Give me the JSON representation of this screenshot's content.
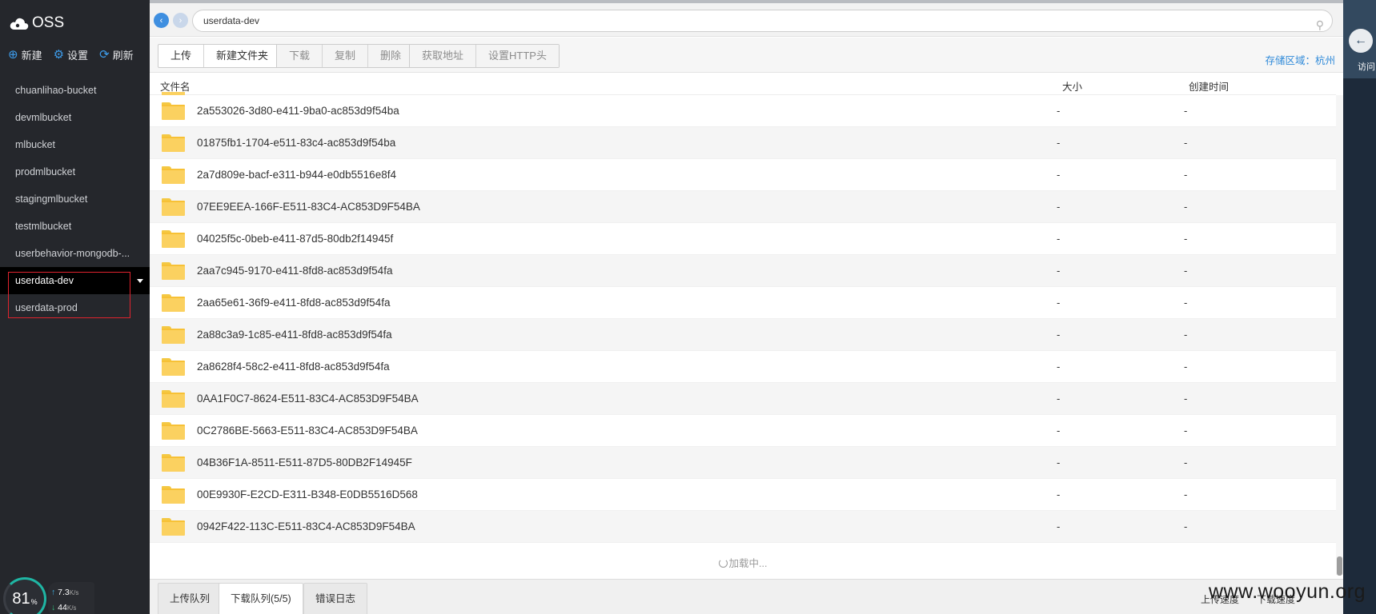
{
  "app": {
    "logo_text": "OSS"
  },
  "sidebar": {
    "actions": [
      {
        "icon": "plus-circle-icon",
        "label": "新建"
      },
      {
        "icon": "gear-icon",
        "label": "设置"
      },
      {
        "icon": "refresh-icon",
        "label": "刷新"
      }
    ],
    "buckets": [
      {
        "label": "chuanlihao-bucket"
      },
      {
        "label": "devmlbucket"
      },
      {
        "label": "mlbucket"
      },
      {
        "label": "prodmlbucket"
      },
      {
        "label": "stagingmlbucket"
      },
      {
        "label": "testmlbucket"
      },
      {
        "label": "userbehavior-mongodb-..."
      },
      {
        "label": "userdata-dev",
        "active": true
      },
      {
        "label": "userdata-prod"
      }
    ],
    "gauge": {
      "value": "81",
      "unit": "%"
    },
    "speed": {
      "up": "7.3",
      "up_unit": "K/s",
      "down": "44",
      "down_unit": "K/s"
    }
  },
  "nav": {
    "address": "userdata-dev"
  },
  "toolbar": {
    "group1": [
      "上传",
      "新建文件夹"
    ],
    "group2": [
      "下载",
      "复制",
      "删除"
    ],
    "group3": [
      "获取地址",
      "设置HTTP头"
    ],
    "region": "存储区域：杭州"
  },
  "list": {
    "headers": {
      "name": "文件名",
      "size": "大小",
      "time": "创建时间"
    },
    "rows": [
      {
        "name": "2a553026-3d80-e411-9ba0-ac853d9f54ba",
        "size": "-",
        "time": "-"
      },
      {
        "name": "01875fb1-1704-e511-83c4-ac853d9f54ba",
        "size": "-",
        "time": "-"
      },
      {
        "name": "2a7d809e-bacf-e311-b944-e0db5516e8f4",
        "size": "-",
        "time": "-"
      },
      {
        "name": "07EE9EEA-166F-E511-83C4-AC853D9F54BA",
        "size": "-",
        "time": "-"
      },
      {
        "name": "04025f5c-0beb-e411-87d5-80db2f14945f",
        "size": "-",
        "time": "-"
      },
      {
        "name": "2aa7c945-9170-e411-8fd8-ac853d9f54fa",
        "size": "-",
        "time": "-"
      },
      {
        "name": "2aa65e61-36f9-e411-8fd8-ac853d9f54fa",
        "size": "-",
        "time": "-"
      },
      {
        "name": "2a88c3a9-1c85-e411-8fd8-ac853d9f54fa",
        "size": "-",
        "time": "-"
      },
      {
        "name": "2a8628f4-58c2-e411-8fd8-ac853d9f54fa",
        "size": "-",
        "time": "-"
      },
      {
        "name": "0AA1F0C7-8624-E511-83C4-AC853D9F54BA",
        "size": "-",
        "time": "-"
      },
      {
        "name": "0C2786BE-5663-E511-83C4-AC853D9F54BA",
        "size": "-",
        "time": "-"
      },
      {
        "name": "04B36F1A-8511-E511-87D5-80DB2F14945F",
        "size": "-",
        "time": "-"
      },
      {
        "name": "00E9930F-E2CD-E311-B348-E0DB5516D568",
        "size": "-",
        "time": "-"
      },
      {
        "name": "0942F422-113C-E511-83C4-AC853D9F54BA",
        "size": "-",
        "time": "-"
      }
    ],
    "loading_text": "加载中..."
  },
  "bottom": {
    "tabs": [
      "上传队列",
      "下载队列(5/5)",
      "错误日志"
    ],
    "active_tab": 1,
    "right": [
      "上传速度",
      "下载速度"
    ]
  },
  "right_strip": {
    "text": "访问"
  },
  "watermark": "www.wooyun.org",
  "colors": {
    "accent": "#2f8ad9",
    "sidebar_bg": "#25272c",
    "folder": "#fbd160",
    "highlight": "#e0232e"
  }
}
